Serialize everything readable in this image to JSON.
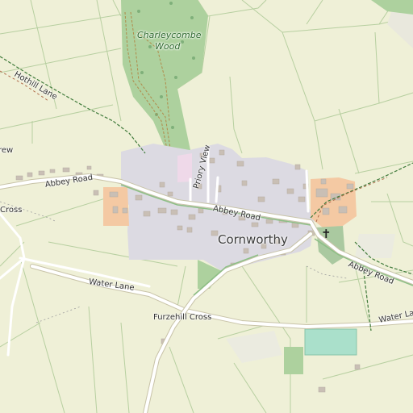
{
  "map": {
    "places": {
      "village": "Cornworthy",
      "wood": "Charleycombe Wood",
      "cross_west": "Cross",
      "furzehill": "Furzehill Cross",
      "crew_fragment": "rew"
    },
    "roads": {
      "abbey_west": "Abbey Road",
      "abbey_center": "Abbey Road",
      "abbey_east": "Abbey Road",
      "priory": "Priory View",
      "water_west": "Water Lane",
      "water_east": "Water Lan",
      "hothill": "Hothill Lane"
    },
    "icons": [
      "church-icon"
    ],
    "colors": {
      "background": "#f2efe4",
      "farmland": "#eef0d5",
      "residential": "#dcdae2",
      "forest": "#add19e",
      "farmyard": "#f4c9a3",
      "pitch": "#aae0cb",
      "road": "#ffffff"
    }
  }
}
